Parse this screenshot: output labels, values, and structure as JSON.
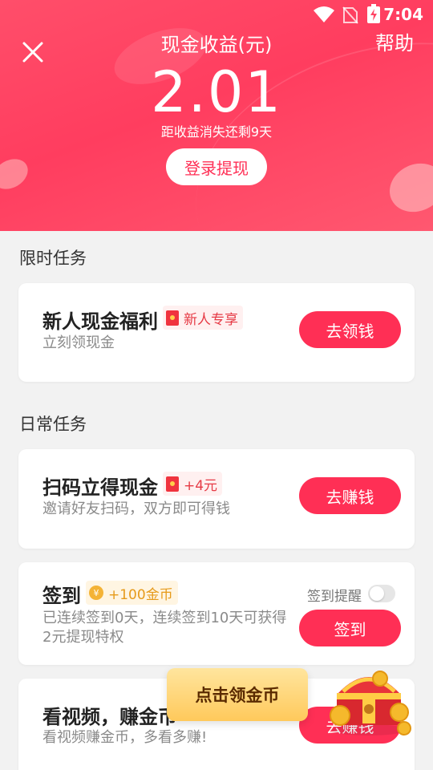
{
  "status_bar": {
    "time": "7:04"
  },
  "header": {
    "title": "现金收益(元)",
    "help": "帮助",
    "amount": "2.01",
    "expire_text": "距收益消失还剩9天",
    "login_button": "登录提现"
  },
  "sections": {
    "limited": {
      "title": "限时任务",
      "tasks": [
        {
          "title": "新人现金福利",
          "badge": "新人专享",
          "desc": "立刻领现金",
          "button": "去领钱"
        }
      ]
    },
    "daily": {
      "title": "日常任务",
      "tasks": [
        {
          "title": "扫码立得现金",
          "badge": "+4元",
          "desc": "邀请好友扫码，双方即可得钱",
          "button": "去赚钱"
        },
        {
          "title": "签到",
          "badge": "+100金币",
          "desc": "已连续签到0天，连续签到10天可获得2元提现特权",
          "remind_label": "签到提醒",
          "reminder_on": false,
          "button": "签到"
        },
        {
          "title": "看视频，赚金币",
          "desc": "看视频赚金币，多看多赚!",
          "button": "去赚钱"
        }
      ]
    }
  },
  "floating": {
    "tooltip": "点击领金币"
  },
  "icons": {
    "close": "close-icon",
    "wifi": "wifi-icon",
    "sim": "sim-off-icon",
    "battery": "battery-charging-icon",
    "redpacket": "red-packet-icon",
    "coin": "coin-icon",
    "chest": "treasure-chest-icon"
  },
  "colors": {
    "accent": "#ff2f55",
    "header_bg": "#ff4565",
    "page_bg": "#f2f2f2",
    "badge_gold": "#e69a1a"
  }
}
